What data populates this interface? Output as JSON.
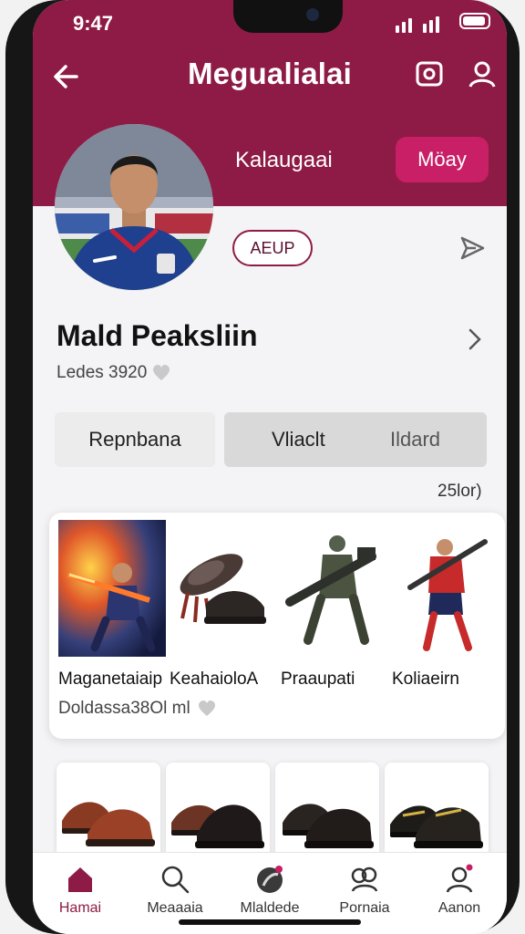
{
  "status": {
    "time": "9:47"
  },
  "header": {
    "title": "Megualialai",
    "channel_name": "Kalaugaai",
    "follow_label": "Möay"
  },
  "profile": {
    "tag": "AEUP",
    "name": "Mald Peaksliin",
    "likes": "Ledes 3920"
  },
  "segments": {
    "left": "Repnbana",
    "right_a": "Vliaclt",
    "right_b": "Ildard"
  },
  "count": "25lor)",
  "featured": {
    "item_titles": [
      "Maganetaiaip",
      "KeahaioloA",
      "Praaupati",
      "Koliaeirn"
    ],
    "subtitle": "Doldassa38Ol ml"
  },
  "tabs": [
    {
      "label": "Hamai",
      "icon": "home-icon"
    },
    {
      "label": "Meaaaia",
      "icon": "search-icon"
    },
    {
      "label": "Mlaldede",
      "icon": "explore-icon"
    },
    {
      "label": "Pornaia",
      "icon": "community-icon"
    },
    {
      "label": "Aanon",
      "icon": "profile-icon"
    }
  ],
  "colors": {
    "brand": "#8e1b45",
    "accent": "#c81f66"
  }
}
